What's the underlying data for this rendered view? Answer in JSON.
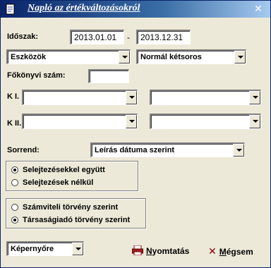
{
  "window": {
    "title": "Napló az értékváltozásokról"
  },
  "period": {
    "label": "Időszak:",
    "from": "2013.01.01",
    "to": "2013.12.31",
    "separator": "-"
  },
  "asset_type": {
    "selected": "Eszközök"
  },
  "format": {
    "selected": "Normál kétsoros"
  },
  "ledger": {
    "label": "Főkönyvi szám:",
    "value": ""
  },
  "k1": {
    "label": "K I.",
    "left": "",
    "right": ""
  },
  "k2": {
    "label": "K II.",
    "left": "",
    "right": ""
  },
  "sort": {
    "label": "Sorrend:",
    "selected": "Leírás dátuma szerint"
  },
  "disposal_group": {
    "options": [
      {
        "label": "Selejtezésekkel együtt",
        "checked": true
      },
      {
        "label": "Selejtezések nélkül",
        "checked": false
      }
    ]
  },
  "law_group": {
    "options": [
      {
        "label": "Számviteli törvény szerint",
        "checked": false
      },
      {
        "label": "Társaságiadó törvény szerint",
        "checked": true
      }
    ]
  },
  "output": {
    "selected": "Képernyőre"
  },
  "buttons": {
    "print_underlined": "N",
    "print_rest": "yomtatás",
    "cancel_underlined": "M",
    "cancel_rest": "égsem"
  },
  "colors": {
    "titlebar_start": "#0a246a",
    "titlebar_end": "#a6caf0",
    "dialog_bg": "#ece9d8"
  }
}
